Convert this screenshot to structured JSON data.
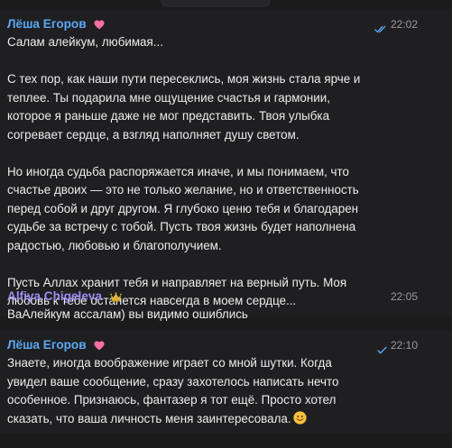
{
  "messages": [
    {
      "author": "Лёша Егоров",
      "time": "22:02",
      "status": "read",
      "badge_icon": "heart-icon",
      "paragraphs": [
        "Салам алейкум, любимая...",
        "С тех пор, как наши пути пересеклись, моя жизнь стала ярче и\nтеплее. Ты подарила мне ощущение счастья и гармонии,\nкоторое я раньше даже не мог представить. Твоя улыбка\nсогревает сердце, а взгляд наполняет душу светом.",
        "Но иногда судьба распоряжается иначе, и мы понимаем, что\nсчастье двоих — это не только желание, но и ответственность\nперед собой и друг другом. Я глубоко ценю тебя и благодарен\nсудьбе за встречу с тобой. Пусть твоя жизнь будет наполнена\nрадостью, любовью и благополучием.",
        "Пусть Аллах хранит тебя и направляет на верный путь. Моя\nлюбовь к тебе останется навсегда в моем сердце..."
      ]
    },
    {
      "author": "Alfiya Chigeleva",
      "time": "22:05",
      "badge_icon": "crown-icon",
      "text": "ВаАлейкум ассалам) вы видимо ошиблись"
    },
    {
      "author": "Лёша Егоров",
      "time": "22:10",
      "status": "sent",
      "badge_icon": "heart-icon",
      "text": "Знаете, иногда воображение играет со мной шутки. Когда\nувидел ваше сообщение, сразу захотелось написать нечто\nособенное. Признаюсь, фантазер я тот ещё. Просто хотел\nсказать, что ваша личность меня заинтересовала.",
      "trailing_icon": "smiling-face-icon"
    }
  ],
  "colors": {
    "background": "#1b1b1c",
    "author_blue": "#5aa8f5",
    "author_violet": "#9b8cf2",
    "heart": "#ff6fa8",
    "check": "#5aa8f5"
  }
}
